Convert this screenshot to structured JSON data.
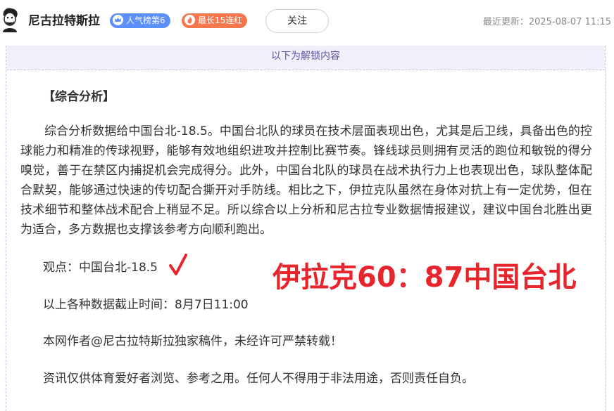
{
  "header": {
    "author_name": "尼古拉特斯拉",
    "rank_badge": "人气榜第6",
    "streak_badge": "最长15连红",
    "follow_label": "关注",
    "updated_label": "最近更新：",
    "updated_time": "2025-08-07 11:15"
  },
  "unlock_bar": "以下为解锁内容",
  "article": {
    "section_title": "【综合分析】",
    "paragraph": "综合分析数据给中国台北-18.5。中国台北队的球员在技术层面表现出色，尤其是后卫线，具备出色的控球能力和精准的传球视野，能够有效地组织进攻并控制比赛节奏。锋线球员则拥有灵活的跑位和敏锐的得分嗅觉，善于在禁区内捕捉机会完成得分。此外，中国台北队的球员在战术执行力上也表现出色，球队整体配合默契，能够通过快速的传切配合撕开对手防线。相比之下，伊拉克队虽然在身体对抗上有一定优势，但在技术细节和整体战术配合上稍显不足。所以综合以上分析和尼古拉专业数据情报建议，建议中国台北胜出更为适合，多方数据也支撑该参考方向顺利跑出。",
    "viewpoint": "观点：中国台北-18.5",
    "result_overlay": "伊拉克60：87中国台北",
    "cutoff": "以上各种数据截止时间：8月7日11:00",
    "copyright": "本网作者@尼古拉特斯拉独家稿件，未经许可严禁转载！",
    "disclaimer": "资讯仅供体育爱好者浏览、参考之用。任何人不得用于非法用途，否则责任自负。"
  },
  "colors": {
    "rank_badge": "#5b8ff9",
    "streak_badge": "#f5774e",
    "result_red": "#e8242c",
    "unlock_bg": "#f1effa"
  },
  "icons": [
    "avatar-portrait",
    "crown-icon",
    "flame-icon",
    "check-mark-icon"
  ]
}
